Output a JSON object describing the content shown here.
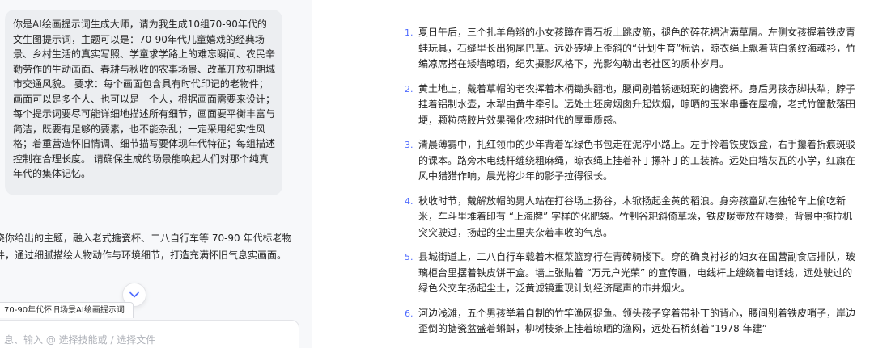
{
  "chat": {
    "user_message": "你是AI绘画提示词生成大师，请为我生成10组70-90年代的文生图提示词，主题可以是：70-90年代儿童嬉戏的经典场景、乡村生活的真实写照、学童求学路上的难忘瞬间、农民辛勤劳作的生动画面、春耕与秋收的农事场景、改革开放初期城市交通风貌。 要求：每个画面包含具有时代印记的老物件；画面可以是多个人、也可以是一个人，根据画面需要来设计；每个提示词要尽可能详细地描述所有细节，画面要平衡丰富与简洁，既要有足够的要素，也不能杂乱；一定采用纪实性风格；着重营造怀旧情调、细节描写要体现年代特征；每组描述控制在合理长度。 请确保生成的场景能唤起人们对那个纯真年代的集体记忆。",
    "assistant_intro": "绕你给出的主题，融入老式搪瓷杯、二八自行车等 70-90 年代标老物件，通过细腻描绘人物动作与环境细节，打造充满怀旧气息实画面。",
    "scroll_down_icon": "chevron-down-icon",
    "skill_tag": "70-90年代怀旧场景AI绘画提示词",
    "input_placeholder": "息、输入 @ 选择技能或 / 选择文件"
  },
  "prompts": [
    {
      "num": "1.",
      "text": "夏日午后，三个扎羊角辫的小女孩蹲在青石板上跳皮筋，褪色的碎花裙沾满草屑。左侧女孩握着铁皮青蛙玩具，石缝里长出狗尾巴草。远处砖墙上歪斜的“计划生育”标语，晾衣绳上飘着蓝白条纹海魂衫，竹编凉席搭在矮墙晾晒，纪实摄影风格下，光影勾勒出老社区的质朴岁月。"
    },
    {
      "num": "2.",
      "text": "黄土地上，戴着草帽的老农挥着木柄锄头翻地，腰间别着锈迹斑斑的搪瓷杯。身后男孩赤脚扶犁，脖子挂着铝制水壶，木犁由黄牛牵引。远处土坯房烟囱升起炊烟，晾晒的玉米串垂在屋檐，老式竹筐散落田埂，颗粒感胶片效果强化农耕时代的厚重质感。"
    },
    {
      "num": "3.",
      "text": "清晨薄雾中，扎红领巾的少年背着军绿色书包走在泥泞小路上。左手拎着铁皮饭盒，右手攥着折痕斑驳的课本。路旁木电线杆缠绕粗麻绳，晾衣绳上挂着补丁摞补丁的工装裤。远处白墙灰瓦的小学，红旗在风中猎猎作响，晨光将少年的影子拉得很长。"
    },
    {
      "num": "4.",
      "text": "秋收时节，戴解放帽的男人站在打谷场上扬谷，木锨扬起金黄的稻浪。身旁孩童趴在独轮车上偷吃新米，车斗里堆着印有 “上海牌” 字样的化肥袋。竹制谷耙斜倚草垛，铁皮暖壶放在矮凳，背景中拖拉机突突驶过，扬起的尘土里夹杂着丰收的气息。"
    },
    {
      "num": "5.",
      "text": "县城街道上，二八自行车载着木框菜篮穿行在青砖骑楼下。穿的确良衬衫的妇女在国营副食店排队，玻璃柜台里摆着铁皮饼干盒。墙上张贴着 “万元户光荣” 的宣传画，电线杆上缠绕着电话线，远处驶过的绿色公交车扬起尘土，泛黄滤镜重现计划经济尾声的市井烟火。"
    },
    {
      "num": "6.",
      "text": "河边浅滩，五个男孩举着自制的竹竿渔网捉鱼。领头孩子穿着带补丁的背心，腰间别着铁皮哨子，岸边歪倒的搪瓷盆盛着蝌蚪，柳树枝条上挂着晾晒的渔网，远处石桥刻着“1978 年建”"
    }
  ]
}
